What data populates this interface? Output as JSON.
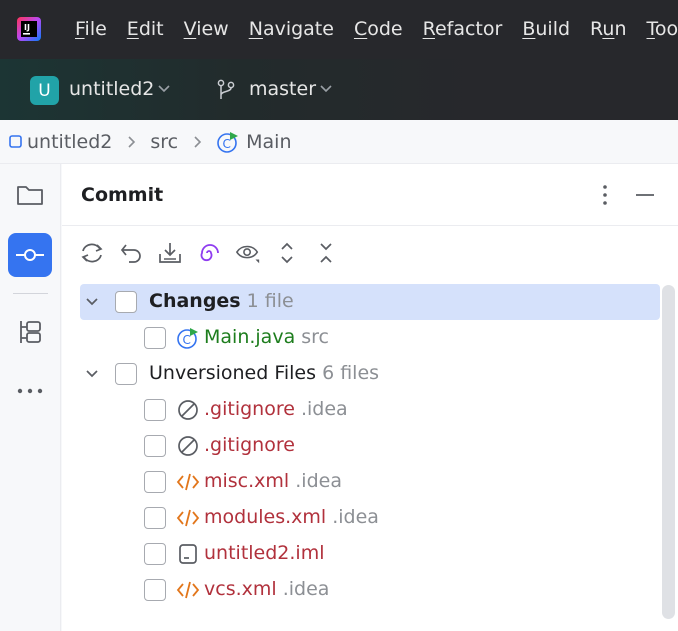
{
  "titlebar": {
    "menu": [
      {
        "label": "File",
        "mnemonic": "F",
        "rest": "ile"
      },
      {
        "label": "Edit",
        "mnemonic": "E",
        "rest": "dit"
      },
      {
        "label": "View",
        "mnemonic": "V",
        "rest": "iew"
      },
      {
        "label": "Navigate",
        "mnemonic": "N",
        "rest": "avigate"
      },
      {
        "label": "Code",
        "mnemonic": "C",
        "rest": "ode"
      },
      {
        "label": "Refactor",
        "mnemonic": "R",
        "rest": "efactor"
      },
      {
        "label": "Build",
        "mnemonic": "B",
        "rest": "uild"
      },
      {
        "label": "Run",
        "pre": "R",
        "mnemonic": "u",
        "rest": "n"
      },
      {
        "label": "Tools",
        "mnemonic": "T",
        "rest": "ools"
      }
    ]
  },
  "project": {
    "badge": "U",
    "name": "untitled2",
    "branch": "master",
    "accent": "#21a3a8"
  },
  "breadcrumb": {
    "module": "untitled2",
    "folder": "src",
    "file": "Main"
  },
  "toolstrip": {
    "items": [
      "folder-icon",
      "commit-icon",
      "structure-icon",
      "more-icon",
      "build-icon"
    ],
    "active": "commit-icon",
    "accent": "#3574f0"
  },
  "commit": {
    "title": "Commit",
    "toolbar_icons": [
      "refresh-icon",
      "rollback-icon",
      "update-icon",
      "ai-assist-icon",
      "preview-icon",
      "expand-all-icon",
      "collapse-all-icon"
    ],
    "changes": {
      "name": "Changes",
      "count": "1 file",
      "files": [
        {
          "name": "Main.java",
          "hint": "src",
          "icon": "java-class-icon",
          "status": "modified"
        }
      ]
    },
    "unversioned": {
      "name": "Unversioned Files",
      "count": "6 files",
      "files": [
        {
          "name": ".gitignore",
          "hint": ".idea",
          "icon": "ignored-file-icon"
        },
        {
          "name": ".gitignore",
          "hint": "",
          "icon": "ignored-file-icon"
        },
        {
          "name": "misc.xml",
          "hint": ".idea",
          "icon": "xml-file-icon"
        },
        {
          "name": "modules.xml",
          "hint": ".idea",
          "icon": "xml-file-icon"
        },
        {
          "name": "untitled2.iml",
          "hint": "",
          "icon": "iml-file-icon"
        },
        {
          "name": "vcs.xml",
          "hint": ".idea",
          "icon": "xml-file-icon"
        }
      ]
    },
    "colors": {
      "modified": "#1d7d1d",
      "unversioned": "#b1313c",
      "selection": "#d5e1fb"
    }
  }
}
